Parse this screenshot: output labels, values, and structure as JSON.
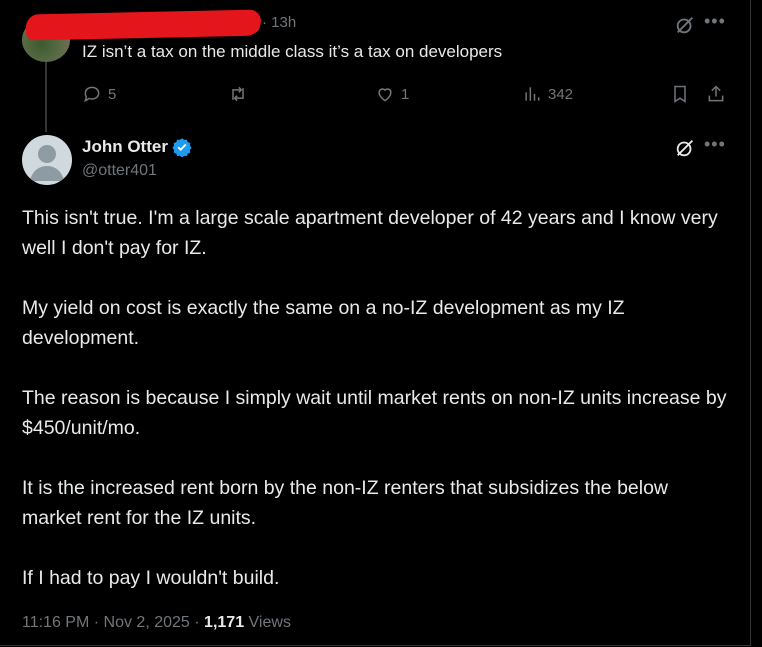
{
  "parent_tweet": {
    "time": "13h",
    "text": "IZ isn’t a tax on the middle class it’s a tax on developers",
    "replies": "5",
    "likes": "1",
    "views": "342"
  },
  "main_tweet": {
    "name": "John Otter",
    "handle": "@otter401",
    "paragraphs": [
      "This isn't true.  I'm a large scale apartment developer of 42 years and I know very well I don't pay for IZ.",
      "My yield on cost is exactly the same on a no-IZ development as my IZ development.",
      "The reason is because I simply wait until market rents on non-IZ units increase by $450/unit/mo.",
      "It is the increased rent born by the non-IZ renters that subsidizes the below market rent for the IZ units.",
      "If I had to pay I wouldn't build."
    ],
    "time": "11:16 PM",
    "date": "Nov 2, 2025",
    "views_count": "1,171",
    "views_label": "Views"
  },
  "icons": {
    "reply": "reply-icon",
    "retweet": "retweet-icon",
    "like": "heart-icon",
    "views": "analytics-icon",
    "bookmark": "bookmark-icon",
    "share": "share-icon",
    "grok": "grok-icon",
    "more": "more-icon",
    "verified": "verified-badge-icon"
  },
  "colors": {
    "background": "#000000",
    "text": "#e7e9ea",
    "muted": "#71767b",
    "verified": "#1d9bf0",
    "redaction": "#e5151c"
  }
}
